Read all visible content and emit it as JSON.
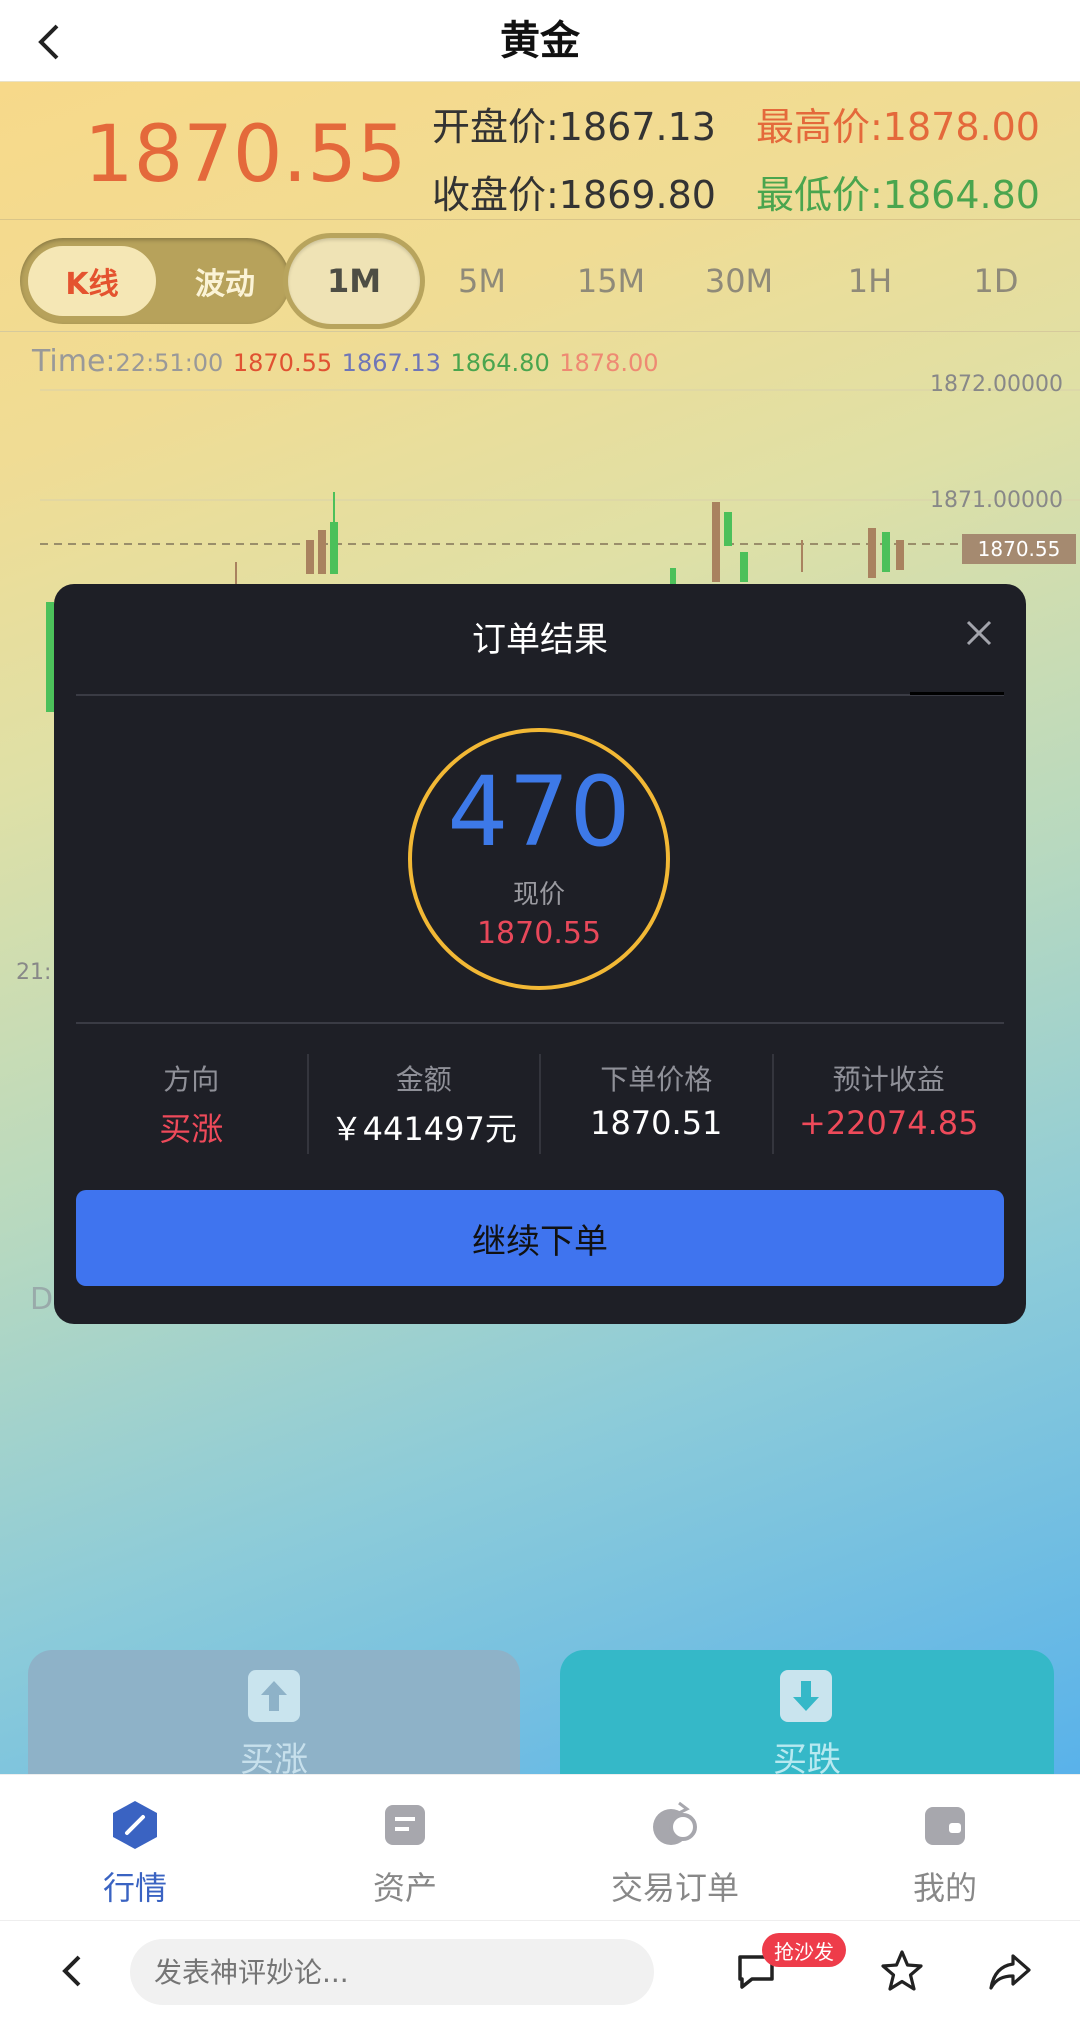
{
  "header": {
    "title": "黄金"
  },
  "quote": {
    "price": "1870.55",
    "open": "开盘价:1867.13",
    "close": "收盘价:1869.80",
    "high": "最高价:1878.00",
    "low": "最低价:1864.80"
  },
  "tabs": {
    "mode_k": "K线",
    "mode_wave": "波动",
    "timeframes": [
      "1M",
      "5M",
      "15M",
      "30M",
      "1H",
      "1D"
    ],
    "active_timeframe": "1M"
  },
  "timeline": {
    "label": "Time:",
    "time": "22:51:00",
    "close": "1870.55",
    "open": "1867.13",
    "low": "1864.80",
    "high": "1878.00"
  },
  "chart": {
    "y_labels": [
      "1872.00000",
      "1871.00000"
    ],
    "current_price_tag": "1870.55",
    "side_labels": {
      "left_time": "21:",
      "left_d": "D"
    }
  },
  "modal": {
    "title": "订单结果",
    "countdown": "470",
    "current_label": "现价",
    "current_price": "1870.55",
    "fields": [
      {
        "label": "方向",
        "value": "买涨"
      },
      {
        "label": "金额",
        "value": "￥441497元"
      },
      {
        "label": "下单价格",
        "value": "1870.51"
      },
      {
        "label": "预计收益",
        "value": "+22074.85"
      }
    ],
    "continue_label": "继续下单"
  },
  "actions": {
    "buy_up": "买涨",
    "buy_down": "买跌"
  },
  "tabbar": [
    {
      "label": "行情"
    },
    {
      "label": "资产"
    },
    {
      "label": "交易订单"
    },
    {
      "label": "我的"
    }
  ],
  "comment": {
    "placeholder": "发表神评妙论...",
    "badge": "抢沙发"
  },
  "colors": {
    "accent_blue": "#3f74ef",
    "up_red": "#ef4a5a",
    "gold": "#f2b835",
    "down_green": "#4aa54e"
  }
}
